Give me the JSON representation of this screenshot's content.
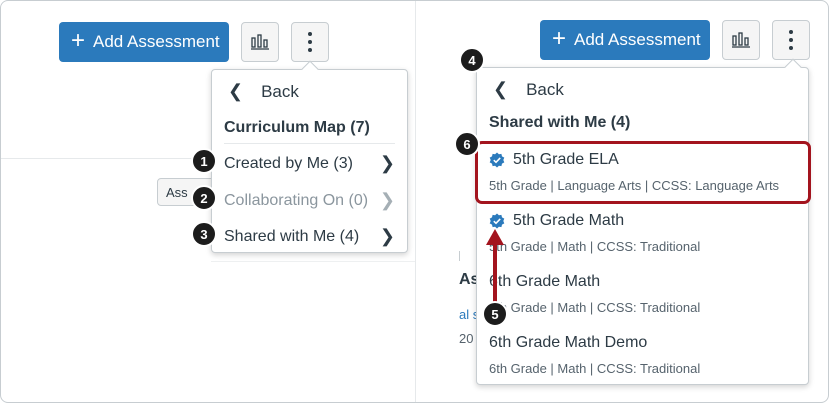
{
  "left": {
    "add_button_label": "Add Assessment",
    "menu": {
      "back_label": "Back",
      "title": "Curriculum Map (7)",
      "items": [
        {
          "label": "Created by Me (3)",
          "disabled": false,
          "step": "1"
        },
        {
          "label": "Collaborating On (0)",
          "disabled": true,
          "step": "2"
        },
        {
          "label": "Shared with Me (4)",
          "disabled": false,
          "step": "3"
        }
      ]
    },
    "background": {
      "partial_button": "Ass"
    }
  },
  "right": {
    "add_button_label": "Add Assessment",
    "menu": {
      "back_label": "Back",
      "title": "Shared with Me (4)",
      "back_step": "4",
      "highlight_step": "6",
      "arrow_step": "5",
      "entries": [
        {
          "title": "5th Grade ELA",
          "meta": "5th Grade  |  Language Arts  |  CCSS: Language Arts",
          "verified": true
        },
        {
          "title": "5th Grade Math",
          "meta": "5th Grade  |  Math  |  CCSS: Traditional",
          "verified": true
        },
        {
          "title": "6th Grade Math",
          "meta": "6th Grade  |  Math  |  CCSS: Traditional",
          "verified": false
        },
        {
          "title": "6th Grade Math Demo",
          "meta": "6th Grade  |  Math  |  CCSS: Traditional",
          "verified": false
        }
      ]
    },
    "background": {
      "partial_heading": "As",
      "partial_link": "al s",
      "partial_date": "20"
    }
  },
  "colors": {
    "primary": "#2b7abc",
    "highlight": "#a3141e",
    "verified": "#2b7abc",
    "badge": "#1c1c1c"
  }
}
